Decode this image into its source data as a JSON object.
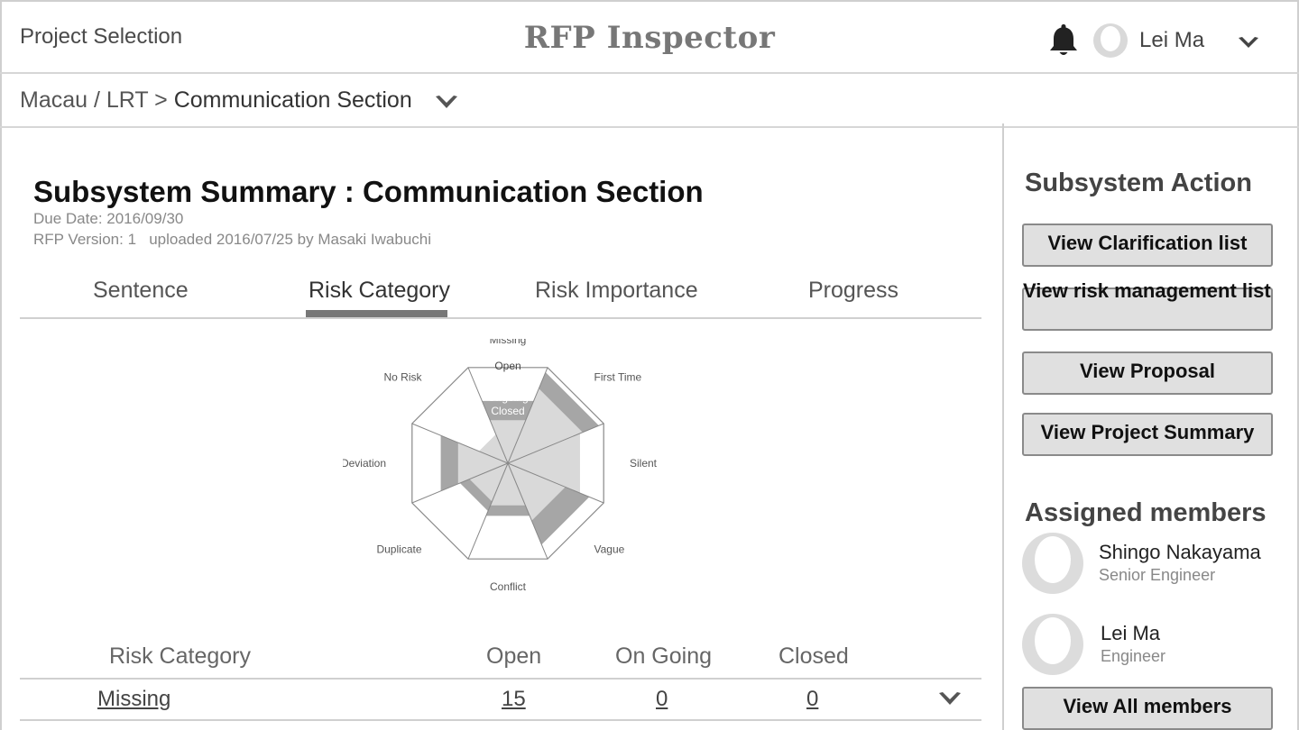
{
  "header": {
    "project_selection": "Project Selection",
    "app_title": "RFP Inspector",
    "user_name": "Lei Ma"
  },
  "breadcrumb": {
    "path": "Macau / LRT > ",
    "current": "Communication Section"
  },
  "summary": {
    "title": "Subsystem Summary : Communication Section",
    "due_date": "Due Date: 2016/09/30",
    "version": "RFP Version: 1   uploaded 2016/07/25 by Masaki Iwabuchi"
  },
  "tabs": [
    {
      "label": "Sentence",
      "active": false
    },
    {
      "label": "Risk Category",
      "active": true
    },
    {
      "label": "Risk Importance",
      "active": false
    },
    {
      "label": "Progress",
      "active": false
    }
  ],
  "chart_data": {
    "type": "radar",
    "axes": [
      "Missing",
      "First Time",
      "Silent",
      "Vague",
      "Conflict",
      "Duplicate",
      "Deviation",
      "No Risk"
    ],
    "legend": [
      "Open",
      "Ongoing",
      "Closed"
    ],
    "series": [
      {
        "name": "Open",
        "values": [
          1.0,
          1.0,
          1.0,
          1.0,
          1.0,
          1.0,
          1.0,
          1.0
        ]
      },
      {
        "name": "Ongoing",
        "values": [
          0.65,
          0.95,
          0.75,
          0.85,
          0.55,
          0.5,
          0.7,
          0.3
        ]
      },
      {
        "name": "Closed",
        "values": [
          0.45,
          0.78,
          0.75,
          0.6,
          0.44,
          0.4,
          0.52,
          0.3
        ]
      }
    ],
    "colors": {
      "outline": "#888888",
      "ongoing": "#a6a6a6",
      "closed": "#d9d9d9"
    }
  },
  "table": {
    "headers": [
      "Risk Category",
      "Open",
      "On Going",
      "Closed"
    ],
    "rows": [
      {
        "category": "Missing",
        "open": "15",
        "ongoing": "0",
        "closed": "0"
      }
    ]
  },
  "sidebar": {
    "actions_heading": "Subsystem Action",
    "actions": [
      "View Clarification list",
      "View risk management list",
      "View Proposal",
      "View Project Summary"
    ],
    "members_heading": "Assigned members",
    "members": [
      {
        "name": "Shingo Nakayama",
        "role": "Senior Engineer"
      },
      {
        "name": "Lei Ma",
        "role": "Engineer"
      }
    ],
    "view_all": "View All members"
  },
  "icons": {
    "bell": "bell-icon",
    "avatar": "user-avatar-icon",
    "chevron": "chevron-down-icon"
  }
}
